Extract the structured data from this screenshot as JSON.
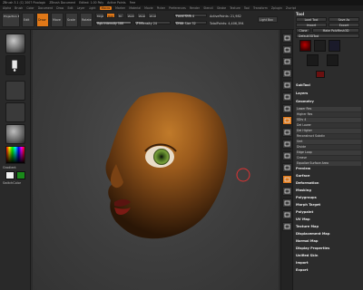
{
  "titlebar": {
    "app": "ZBrush 3.1",
    "items": [
      "ZBrush 3.1 (C) 2007 Pixologic",
      "ZBrush Document",
      "Edited: 1.00 Poly",
      "Active Points",
      "Free"
    ]
  },
  "menubar": {
    "items": [
      "Alpha",
      "Brush",
      "Color",
      "Document",
      "Draw",
      "Edit",
      "Layer",
      "Light",
      "Macro",
      "Marker",
      "Material",
      "Movie",
      "Picker",
      "Preferences",
      "Render",
      "Stencil",
      "Stroke",
      "Texture",
      "Tool",
      "Transform",
      "Zplugin",
      "Zscript"
    ],
    "highlight": "Macro"
  },
  "toolbar": {
    "projection": "Projection Master",
    "edit": "Edit",
    "draw": "Draw",
    "move": "Move",
    "scale": "Scale",
    "rotate": "Rotate",
    "mrgb": "Mrgb",
    "rgb": "Rgb",
    "m": "M",
    "zadd": "Zadd",
    "zsub": "Zsub",
    "zcut": "Zcut",
    "rgb_intensity": "Rgb Intensity 100",
    "z_intensity": "Z Intensity 24",
    "focal_shift": "Focal Shift 0",
    "draw_size": "Draw Size 32",
    "active_points": "ActivePoints: 21,982",
    "total_points": "TotalPoints: 4,406,394",
    "light_box": "Light Box"
  },
  "leftshelf": {
    "gradient_label": "Gradient",
    "switch_color_label": "SwitchColor",
    "main_color": "#f0f0f0",
    "secondary_color": "#1a8a1a"
  },
  "tray": {
    "title": "Tool",
    "buttons": [
      "Load Tool",
      "Save As",
      "Import",
      "Export",
      "Clone",
      "Make PolyMesh3D"
    ],
    "thumb_label": "Default3DTool",
    "sections": [
      "SubTool",
      "Layers",
      "Geometry",
      "Lower Res",
      "Higher Res",
      "SDiv 4",
      "Del Lower",
      "Del Higher",
      "Reconstruct Subdiv",
      "Smt",
      "Divide",
      "Edge Loop",
      "Crease",
      "Equalize Surface Area",
      "Preview",
      "Surface",
      "Deformation",
      "Masking",
      "Polygroups",
      "Morph Target",
      "Polypaint",
      "UV Map",
      "Texture Map",
      "Displacement Map",
      "Normal Map",
      "Display Properties",
      "Unified Skin",
      "Import",
      "Export"
    ]
  }
}
